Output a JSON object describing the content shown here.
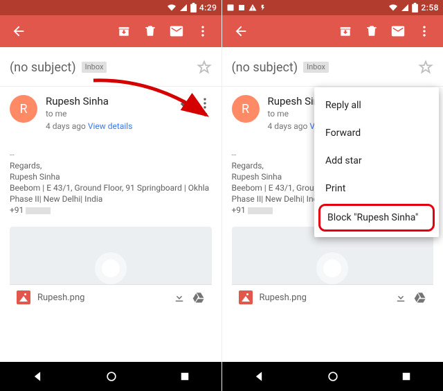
{
  "status": {
    "time_left": "4:29",
    "time_right": "2:58"
  },
  "subject": {
    "title": "(no subject)",
    "label": "Inbox"
  },
  "sender": {
    "initial": "R",
    "name": "Rupesh Sinha",
    "to": "to me",
    "ago": "4 days ago",
    "view_details": "View details"
  },
  "sig": {
    "dash": "--",
    "regards": "Regards,",
    "name": "Rupesh Sinha",
    "address": "Beebom | E 43/1, Ground Floor, 91 Springboard | Okhla Phase II| New Delhi| India",
    "phone_prefix": "+91"
  },
  "attachment": {
    "name": "Rupesh.png"
  },
  "menu": {
    "reply_all": "Reply all",
    "forward": "Forward",
    "add_star": "Add star",
    "print": "Print",
    "block": "Block \"Rupesh Sinha\""
  }
}
